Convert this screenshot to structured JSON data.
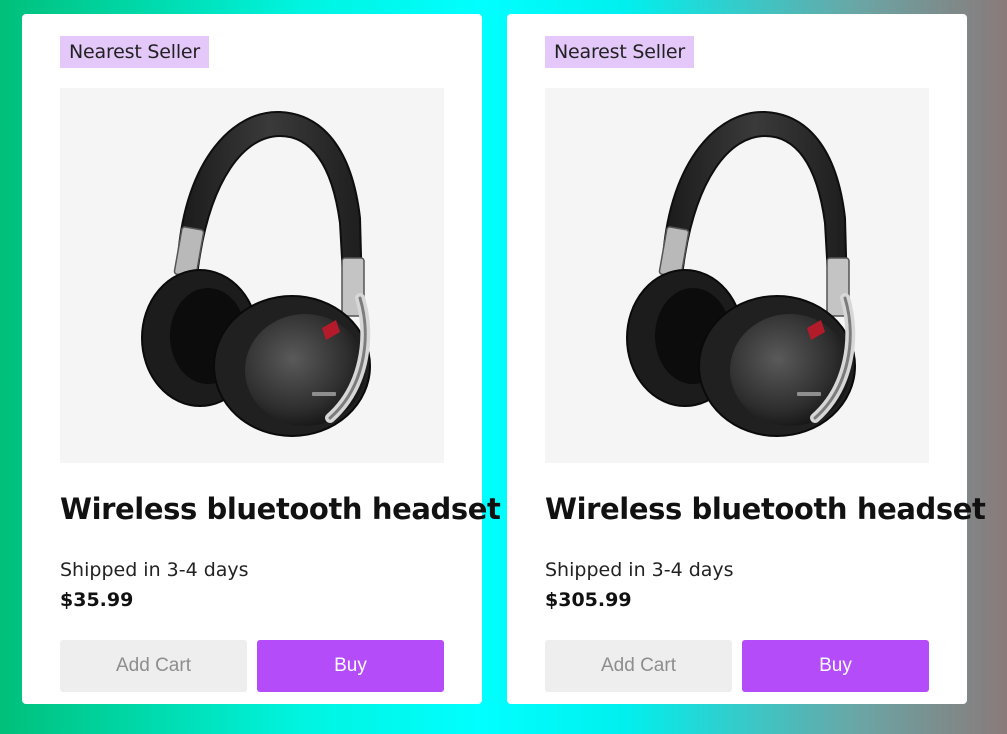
{
  "colors": {
    "badge_bg": "#e3c8f9",
    "buy_button": "#b44cfa",
    "add_cart_button": "#eeeeee",
    "image_bg": "#f5f5f5"
  },
  "products": [
    {
      "badge": "Nearest Seller",
      "image_icon": "headphones-image",
      "title": "Wireless bluetooth headset",
      "shipping": "Shipped in 3-4 days",
      "price": "$35.99",
      "add_cart_label": "Add Cart",
      "buy_label": "Buy"
    },
    {
      "badge": "Nearest Seller",
      "image_icon": "headphones-image",
      "title": "Wireless bluetooth headset",
      "shipping": "Shipped in 3-4 days",
      "price": "$305.99",
      "add_cart_label": "Add Cart",
      "buy_label": "Buy"
    }
  ]
}
